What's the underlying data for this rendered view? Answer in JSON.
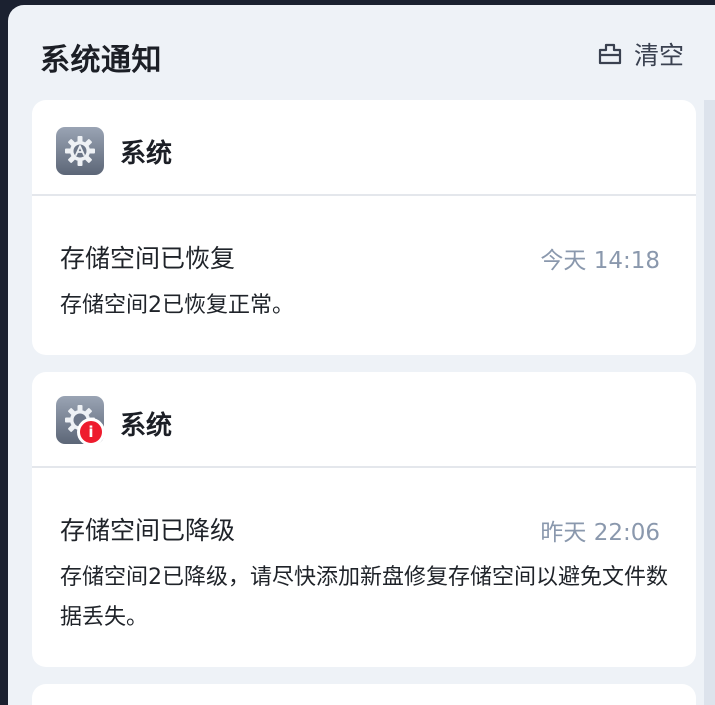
{
  "header": {
    "title": "系统通知",
    "clear_label": "清空"
  },
  "notifications": [
    {
      "app_name": "系统",
      "icon": "gear-icon",
      "has_badge": false,
      "title": "存储空间已恢复",
      "time": "今天 14:18",
      "message": "存储空间2已恢复正常。"
    },
    {
      "app_name": "系统",
      "icon": "gear-icon",
      "has_badge": true,
      "badge_icon": "info-icon",
      "badge_text": "i",
      "title": "存储空间已降级",
      "time": "昨天 22:06",
      "message": "存储空间2已降级，请尽快添加新盘修复存储空间以避免文件数据丢失。"
    }
  ],
  "colors": {
    "badge": "#ee1c2e",
    "time": "#8a98ad",
    "panel_bg": "#eef2f7"
  }
}
